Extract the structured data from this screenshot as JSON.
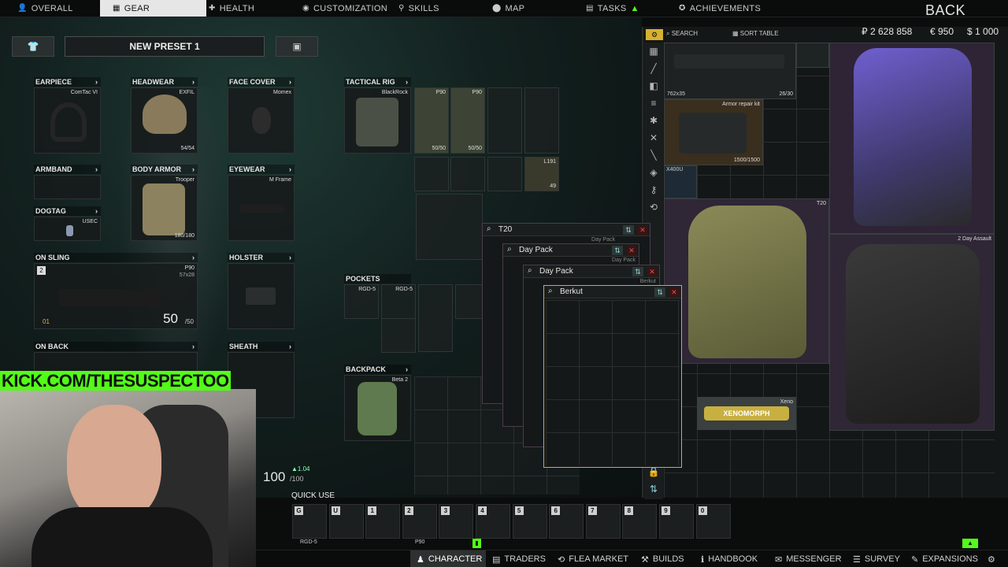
{
  "nav": {
    "tabs": [
      {
        "label": "OVERALL",
        "icon": "person-icon"
      },
      {
        "label": "GEAR",
        "icon": "shirt-icon"
      },
      {
        "label": "HEALTH",
        "icon": "cross-icon"
      },
      {
        "label": "CUSTOMIZATION",
        "icon": "customization-icon"
      },
      {
        "label": "SKILLS",
        "icon": "skills-icon"
      },
      {
        "label": "MAP",
        "icon": "map-pin-icon"
      },
      {
        "label": "TASKS",
        "icon": "tasks-icon"
      },
      {
        "label": "ACHIEVEMENTS",
        "icon": "achievement-icon"
      }
    ],
    "back": "BACK"
  },
  "currency": {
    "rubles": "₽ 2 628 858",
    "euros": "€ 950",
    "dollars": "$ 1 000"
  },
  "preset": {
    "name": "NEW PRESET 1"
  },
  "gear": {
    "earpiece": {
      "label": "EARPIECE",
      "item": "ComTac VI"
    },
    "headwear": {
      "label": "HEADWEAR",
      "item": "EXFIL",
      "count": "54/54"
    },
    "face_cover": {
      "label": "FACE COVER",
      "item": "Momex"
    },
    "armband": {
      "label": "ARMBAND"
    },
    "body_armor": {
      "label": "BODY ARMOR",
      "item": "Trooper",
      "count": "180/180"
    },
    "eyewear": {
      "label": "EYEWEAR",
      "item": "M Frame"
    },
    "dogtag": {
      "label": "DOGTAG",
      "item": "USEC"
    },
    "on_sling": {
      "label": "ON SLING",
      "item": "P90",
      "ammo_type": "57x28",
      "slot_num": "2",
      "ammo": "50",
      "ammo_max": "/50",
      "fire_mode": "01"
    },
    "holster": {
      "label": "HOLSTER"
    },
    "on_back": {
      "label": "ON BACK"
    },
    "sheath": {
      "label": "SHEATH"
    },
    "tactical_rig": {
      "label": "TACTICAL RIG",
      "item": "BlackRock"
    },
    "rig_items": [
      {
        "name": "P90",
        "count": "50/50"
      },
      {
        "name": "P90",
        "count": "50/50"
      },
      {
        "name": "L191",
        "count": "49"
      }
    ],
    "pockets": {
      "label": "POCKETS",
      "items": [
        "RGD-5",
        "RGD-5"
      ]
    },
    "backpack": {
      "label": "BACKPACK",
      "item": "Beta 2"
    }
  },
  "health": {
    "value": "100",
    "max": "/100",
    "regen": "▲1.04"
  },
  "stash": {
    "search": "SEARCH",
    "sort": "SORT TABLE",
    "items": [
      {
        "name": "762x35",
        "count": "26/30"
      },
      {
        "name": "Armor repair kit",
        "count": "1500/1500"
      },
      {
        "name": "X400U"
      },
      {
        "name": "T20"
      },
      {
        "name": "2 Day Assault"
      },
      {
        "name": "Xeno",
        "label": "XENOMORPH"
      }
    ]
  },
  "popups": [
    {
      "title": "T20",
      "hint": "Day Pack"
    },
    {
      "title": "Day Pack",
      "hint": "Day Pack"
    },
    {
      "title": "Day Pack",
      "hint": "Berkut"
    },
    {
      "title": "Berkut"
    }
  ],
  "quick_use": {
    "label": "QUICK USE",
    "slots": [
      {
        "key": "G",
        "item": "RGD-5"
      },
      {
        "key": "U",
        "item": ""
      },
      {
        "key": "1",
        "item": ""
      },
      {
        "key": "2",
        "item": "P90"
      },
      {
        "key": "3",
        "item": ""
      },
      {
        "key": "4",
        "item": ""
      },
      {
        "key": "5",
        "item": ""
      },
      {
        "key": "6",
        "item": ""
      },
      {
        "key": "7",
        "item": ""
      },
      {
        "key": "8",
        "item": ""
      },
      {
        "key": "9",
        "item": ""
      },
      {
        "key": "0",
        "item": ""
      }
    ]
  },
  "bottom_nav": [
    {
      "label": "CHARACTER",
      "icon": "character-icon"
    },
    {
      "label": "TRADERS",
      "icon": "traders-icon"
    },
    {
      "label": "FLEA MARKET",
      "icon": "flea-market-icon"
    },
    {
      "label": "BUILDS",
      "icon": "builds-icon"
    },
    {
      "label": "HANDBOOK",
      "icon": "handbook-icon"
    },
    {
      "label": "MESSENGER",
      "icon": "messenger-icon"
    },
    {
      "label": "SURVEY",
      "icon": "survey-icon"
    },
    {
      "label": "EXPANSIONS",
      "icon": "expansions-icon"
    }
  ],
  "overlay": {
    "stream_link": "KICK.COM/THESUSPECTOO"
  },
  "colors": {
    "accent_green": "#53fc18",
    "active_tab": "#e6e6e6",
    "close_red": "#e05050",
    "stash_purple": "#3a2c3c"
  }
}
